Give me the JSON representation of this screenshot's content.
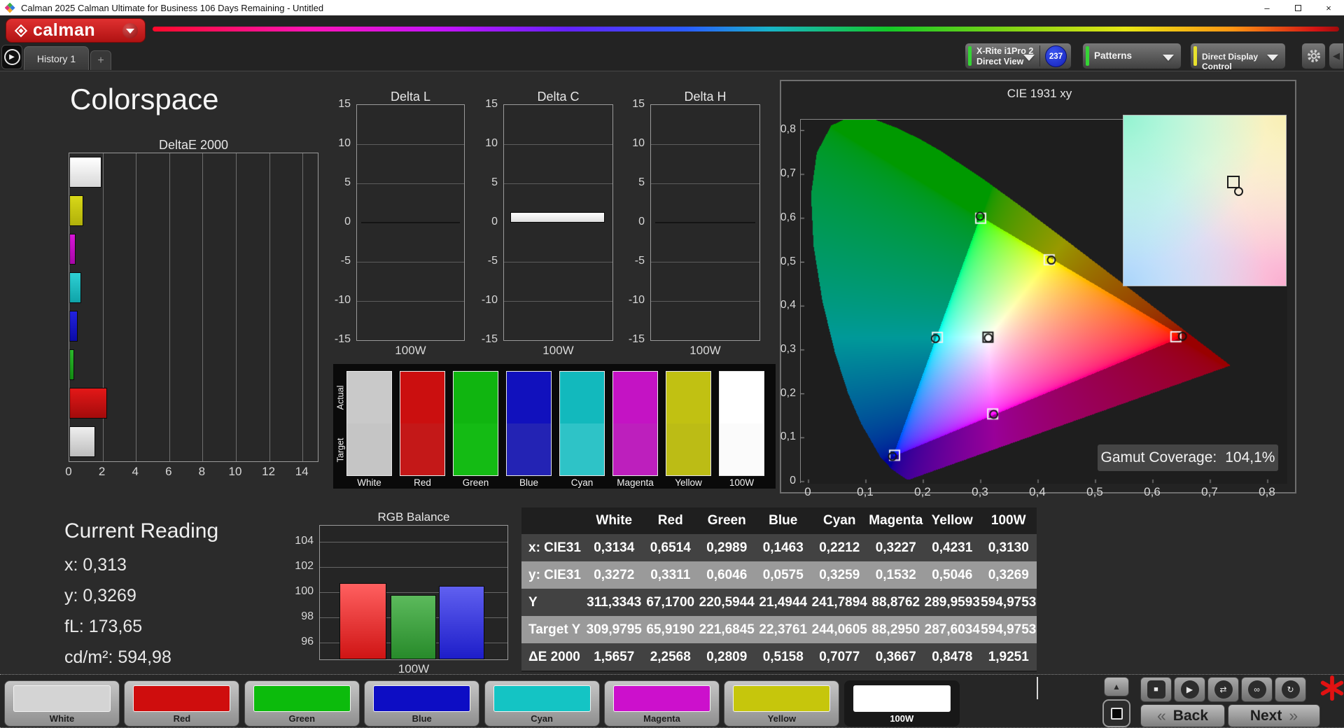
{
  "window": {
    "title": "Calman 2025 Calman Ultimate for Business 106 Days Remaining  - Untitled",
    "minimize_glyph": "–",
    "close_glyph": "×"
  },
  "brand": {
    "logo_text": "calman",
    "brand_red": "#c61818"
  },
  "tab_strip": {
    "tabs": [
      {
        "label": "History 1"
      }
    ],
    "add_label": "+"
  },
  "toolbar": {
    "meter_button": {
      "line1": "X-Rite i1Pro 2",
      "line2": "Direct View",
      "badge": "237",
      "status_color": "#35d435"
    },
    "patterns_button": {
      "label": "Patterns",
      "status_color": "#35d435"
    },
    "display_control_button": {
      "label": "Direct Display Control",
      "status_color": "#e8e12c"
    }
  },
  "page": {
    "title": "Colorspace"
  },
  "chart_data": [
    {
      "id": "deltaE2000",
      "type": "bar",
      "orientation": "horizontal",
      "title": "DeltaE 2000",
      "categories": [
        "100W",
        "Yellow",
        "Magenta",
        "Cyan",
        "Blue",
        "Green",
        "Red",
        "White"
      ],
      "values": [
        1.9251,
        0.8478,
        0.3667,
        0.7077,
        0.5158,
        0.2809,
        2.2568,
        1.5657
      ],
      "bar_colors": [
        [
          "#ffffff",
          "#d8d8d8"
        ],
        [
          "#d8d818",
          "#b0b00a"
        ],
        [
          "#d816d8",
          "#a607a6"
        ],
        [
          "#2ed0d4",
          "#0fa3a8"
        ],
        [
          "#2222e0",
          "#0b0ba6"
        ],
        [
          "#2cb82c",
          "#128a12"
        ],
        [
          "#e31818",
          "#a30b0b"
        ],
        [
          "#efefef",
          "#bdbdbd"
        ]
      ],
      "xlim": [
        0,
        15
      ],
      "xticks": [
        0,
        2,
        4,
        6,
        8,
        10,
        12,
        14
      ],
      "grid": true
    },
    {
      "id": "deltaL",
      "type": "bar",
      "title": "Delta L",
      "categories": [
        "100W"
      ],
      "values": [
        0
      ],
      "ylim": [
        -15,
        15
      ],
      "yticks": [
        15,
        10,
        5,
        0,
        -5,
        -10,
        -15
      ],
      "xlabel": "100W"
    },
    {
      "id": "deltaC",
      "type": "bar",
      "title": "Delta C",
      "categories": [
        "100W"
      ],
      "values": [
        1.3
      ],
      "ylim": [
        -15,
        15
      ],
      "yticks": [
        15,
        10,
        5,
        0,
        -5,
        -10,
        -15
      ],
      "xlabel": "100W",
      "bar_color": [
        "#ffffff",
        "#dedede"
      ]
    },
    {
      "id": "deltaH",
      "type": "bar",
      "title": "Delta H",
      "categories": [
        "100W"
      ],
      "values": [
        0
      ],
      "ylim": [
        -15,
        15
      ],
      "yticks": [
        15,
        10,
        5,
        0,
        -5,
        -10,
        -15
      ],
      "xlabel": "100W"
    },
    {
      "id": "rgbBalance",
      "type": "bar",
      "title": "RGB Balance",
      "categories": [
        "Red",
        "Green",
        "Blue"
      ],
      "values": [
        100.7,
        99.8,
        100.5
      ],
      "ylim": [
        94.6,
        105.3
      ],
      "yticks": [
        96,
        98,
        100,
        102,
        104
      ],
      "xlabel": "100W",
      "bar_colors": [
        [
          "#ff6060",
          "#cf1414"
        ],
        [
          "#5cba5c",
          "#278a2a"
        ],
        [
          "#6060f0",
          "#1d1dc9"
        ]
      ]
    },
    {
      "id": "cie1931",
      "type": "scatter",
      "title": "CIE 1931 xy",
      "xlim": [
        0,
        0.84
      ],
      "ylim": [
        0,
        0.86
      ],
      "xtick_labels": [
        "0",
        "0,1",
        "0,2",
        "0,3",
        "0,4",
        "0,5",
        "0,6",
        "0,7",
        "0,8"
      ],
      "xtick_values": [
        0,
        0.1,
        0.2,
        0.3,
        0.4,
        0.5,
        0.6,
        0.7,
        0.8
      ],
      "ytick_labels": [
        "0",
        "0,1",
        "0,2",
        "0,3",
        "0,4",
        "0,5",
        "0,6",
        "0,7",
        "0,8"
      ],
      "ytick_values": [
        0,
        0.1,
        0.2,
        0.3,
        0.4,
        0.5,
        0.6,
        0.7,
        0.8
      ],
      "gamut_triangle": {
        "red": [
          0.6514,
          0.3311
        ],
        "green": [
          0.2989,
          0.6046
        ],
        "blue": [
          0.1463,
          0.0575
        ]
      },
      "targets": [
        {
          "name": "white",
          "x": 0.3127,
          "y": 0.329
        },
        {
          "name": "red",
          "x": 0.64,
          "y": 0.33
        },
        {
          "name": "green",
          "x": 0.3,
          "y": 0.6
        },
        {
          "name": "blue",
          "x": 0.15,
          "y": 0.06
        },
        {
          "name": "cyan",
          "x": 0.2246,
          "y": 0.3287
        },
        {
          "name": "magenta",
          "x": 0.3209,
          "y": 0.1542
        },
        {
          "name": "yellow",
          "x": 0.4193,
          "y": 0.5053
        }
      ],
      "measured": [
        {
          "name": "white",
          "x": 0.3134,
          "y": 0.3272
        },
        {
          "name": "red",
          "x": 0.6514,
          "y": 0.3311
        },
        {
          "name": "green",
          "x": 0.2989,
          "y": 0.6046
        },
        {
          "name": "blue",
          "x": 0.1463,
          "y": 0.0575
        },
        {
          "name": "cyan",
          "x": 0.2212,
          "y": 0.3259
        },
        {
          "name": "magenta",
          "x": 0.3227,
          "y": 0.1532
        },
        {
          "name": "yellow",
          "x": 0.4231,
          "y": 0.5046
        }
      ]
    }
  ],
  "gamut": {
    "label": "Gamut Coverage:",
    "value": "104,1%"
  },
  "current_reading": {
    "title": "Current Reading",
    "items": [
      {
        "label": "x",
        "value": "0,313"
      },
      {
        "label": "y",
        "value": "0,3269"
      },
      {
        "label": "fL",
        "value": "173,65"
      },
      {
        "label": "cd/m²",
        "value": "594,98"
      }
    ]
  },
  "swatch_panel": {
    "row_labels": [
      "Actual",
      "Target"
    ],
    "columns": [
      {
        "name": "White",
        "actual": "#c9c9c9",
        "target": "#c5c5c5"
      },
      {
        "name": "Red",
        "actual": "#cb0f0f",
        "target": "#c41818"
      },
      {
        "name": "Green",
        "actual": "#10b510",
        "target": "#14bb14"
      },
      {
        "name": "Blue",
        "actual": "#1111bd",
        "target": "#2323b4"
      },
      {
        "name": "Cyan",
        "actual": "#12b9bd",
        "target": "#2ec3c7"
      },
      {
        "name": "Magenta",
        "actual": "#c413c4",
        "target": "#bd1fbd"
      },
      {
        "name": "Yellow",
        "actual": "#c1c112",
        "target": "#bcbc15"
      },
      {
        "name": "100W",
        "actual": "#ffffff",
        "target": "#fbfbfb"
      }
    ]
  },
  "table": {
    "columns": [
      "White",
      "Red",
      "Green",
      "Blue",
      "Cyan",
      "Magenta",
      "Yellow",
      "100W"
    ],
    "rows": [
      {
        "label": "x: CIE31",
        "highlight": false,
        "values": [
          "0,3134",
          "0,6514",
          "0,2989",
          "0,1463",
          "0,2212",
          "0,3227",
          "0,4231",
          "0,3130"
        ]
      },
      {
        "label": "y: CIE31",
        "highlight": true,
        "values": [
          "0,3272",
          "0,3311",
          "0,6046",
          "0,0575",
          "0,3259",
          "0,1532",
          "0,5046",
          "0,3269"
        ]
      },
      {
        "label": "Y",
        "highlight": false,
        "values": [
          "311,3343",
          "67,1700",
          "220,5944",
          "21,4944",
          "241,7894",
          "88,8762",
          "289,9593",
          "594,9753"
        ]
      },
      {
        "label": "Target Y",
        "highlight": true,
        "values": [
          "309,9795",
          "65,9190",
          "221,6845",
          "22,3761",
          "244,0605",
          "88,2950",
          "287,6034",
          "594,9753"
        ]
      },
      {
        "label": "ΔE 2000",
        "highlight": false,
        "values": [
          "1,5657",
          "2,2568",
          "0,2809",
          "0,5158",
          "0,7077",
          "0,3667",
          "0,8478",
          "1,9251"
        ]
      }
    ]
  },
  "bottom_bar": {
    "patches": [
      {
        "label": "White",
        "color": "#d4d4d4",
        "selected": false
      },
      {
        "label": "Red",
        "color": "#cf0d0d",
        "selected": false
      },
      {
        "label": "Green",
        "color": "#0cbb0c",
        "selected": false
      },
      {
        "label": "Blue",
        "color": "#0d0dc4",
        "selected": false
      },
      {
        "label": "Cyan",
        "color": "#14c4c4",
        "selected": false
      },
      {
        "label": "Magenta",
        "color": "#cc10cc",
        "selected": false
      },
      {
        "label": "Yellow",
        "color": "#c6c60c",
        "selected": false
      },
      {
        "label": "100W",
        "color": "#ffffff",
        "selected": true
      }
    ],
    "transport": [
      {
        "name": "stop",
        "glyph": "■"
      },
      {
        "name": "play",
        "glyph": "▶"
      },
      {
        "name": "step",
        "glyph": "⇄"
      },
      {
        "name": "continuous",
        "glyph": "∞"
      },
      {
        "name": "loop",
        "glyph": "↻"
      }
    ],
    "up_glyph": "▲",
    "back_label": "Back",
    "back_icon": "«",
    "next_label": "Next",
    "next_icon": "»"
  }
}
